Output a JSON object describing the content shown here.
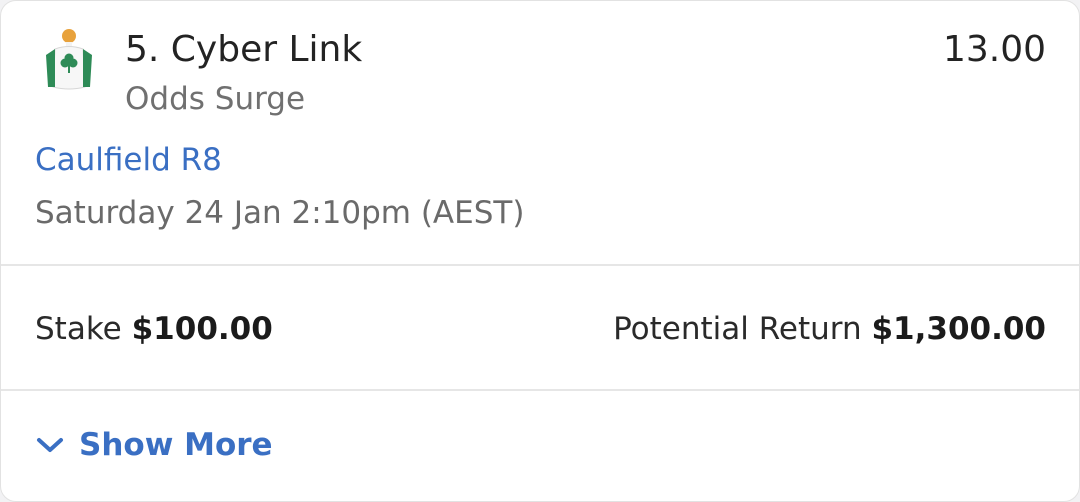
{
  "runner": {
    "number_name": "5. Cyber Link",
    "subtitle": "Odds Surge",
    "odds": "13.00"
  },
  "race": {
    "venue": "Caulfield R8",
    "datetime": "Saturday 24 Jan 2:10pm (AEST)"
  },
  "bet": {
    "stake_label": "Stake",
    "stake_value": "$100.00",
    "return_label": "Potential Return",
    "return_value": "$1,300.00"
  },
  "footer": {
    "show_more_label": "Show More"
  },
  "icons": {
    "silks": "jockey-silks-icon",
    "chevron": "chevron-down-icon"
  },
  "colors": {
    "link": "#3a6fc3",
    "silks_green": "#2e8b57",
    "silks_cap": "#e8a23c"
  }
}
